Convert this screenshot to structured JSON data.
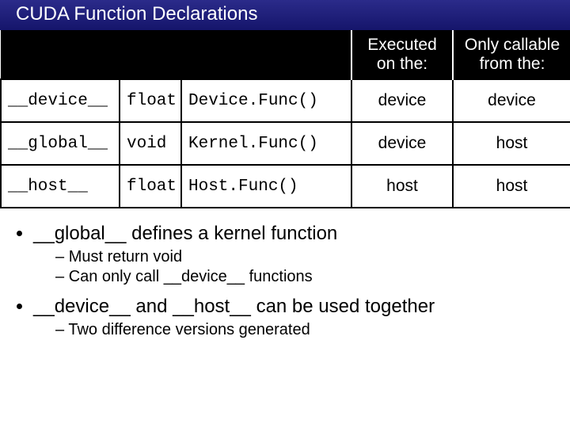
{
  "title": "CUDA Function Declarations",
  "table": {
    "headers": {
      "blank": "",
      "exec": "Executed on the:",
      "call": "Only callable from the:"
    },
    "rows": [
      {
        "qual": "__device__",
        "type": "float",
        "func": "Device.Func()",
        "exec": "device",
        "call": "device"
      },
      {
        "qual": "__global__",
        "type": "void",
        "func": "Kernel.Func()",
        "exec": "device",
        "call": "host"
      },
      {
        "qual": "__host__",
        "type": "float",
        "func": "Host.Func()",
        "exec": "host",
        "call": "host"
      }
    ]
  },
  "bullets": {
    "b1": "__global__ defines a kernel function",
    "b1s1": "Must return void",
    "b1s2": "Can only call __device__ functions",
    "b2": "__device__ and __host__ can be used together",
    "b2s1": "Two difference versions generated"
  }
}
